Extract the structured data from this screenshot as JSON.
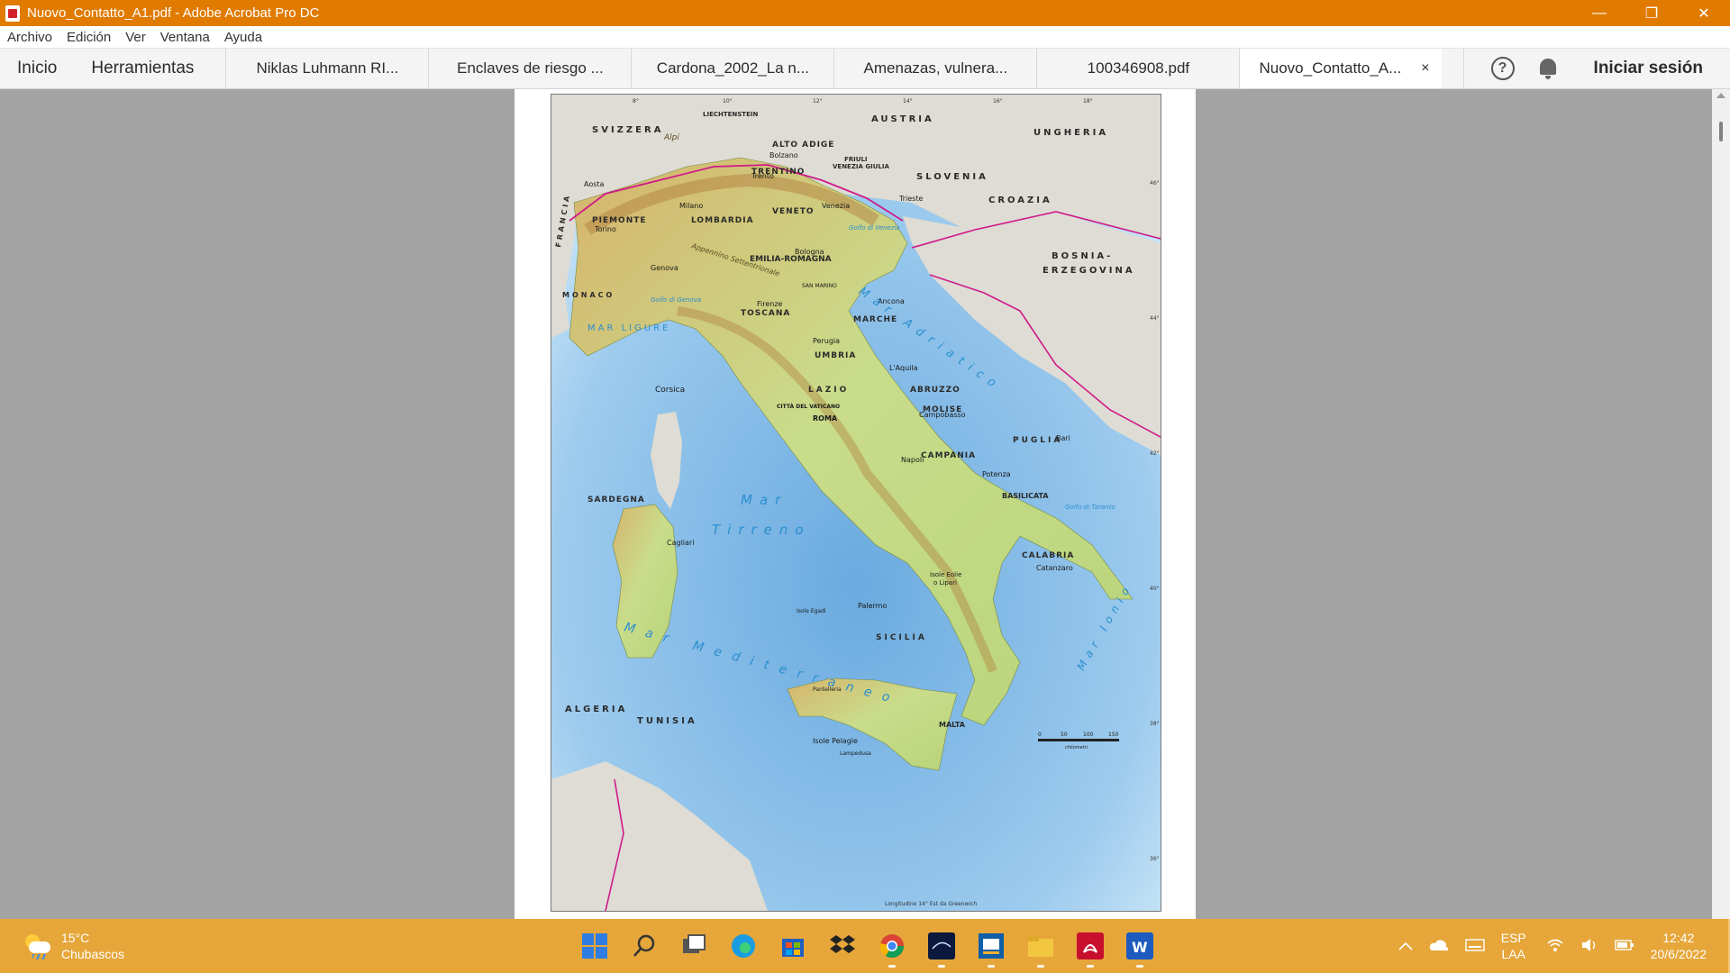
{
  "window": {
    "title": "Nuovo_Contatto_A1.pdf - Adobe Acrobat Pro DC",
    "minimize": "—",
    "restore": "❐",
    "close": "✕"
  },
  "menu": [
    "Archivo",
    "Edición",
    "Ver",
    "Ventana",
    "Ayuda"
  ],
  "toolbar": {
    "home": "Inicio",
    "tools": "Herramientas",
    "tabs": [
      {
        "label": "Niklas Luhmann RI..."
      },
      {
        "label": "Enclaves de riesgo ..."
      },
      {
        "label": "Cardona_2002_La n..."
      },
      {
        "label": "Amenazas, vulnera..."
      },
      {
        "label": "100346908.pdf"
      },
      {
        "label": "Nuovo_Contatto_A...",
        "active": true,
        "close": "×"
      }
    ],
    "help": "?",
    "signin": "Iniciar sesión"
  },
  "map": {
    "sea_labels": {
      "adriatico": "Mar Adriatico",
      "tirreno_1": "Mar",
      "tirreno_2": "Tirreno",
      "mediterraneo": "Mar Mediterraneo",
      "ionio": "Mar Ionio",
      "ligure": "MAR LIGURE",
      "golfo_venezia": "Golfo di Venezia",
      "golfo_genova": "Golfo di Genova",
      "golfo_taranto": "Golfo di Taranto"
    },
    "countries": {
      "svizzera": "SVIZZERA",
      "austria": "AUSTRIA",
      "ungheria": "UNGHERIA",
      "slovenia": "SLOVENIA",
      "croazia": "CROAZIA",
      "bosnia_1": "BOSNIA-",
      "bosnia_2": "ERZEGOVINA",
      "francia": "FRANCIA",
      "monaco": "MONACO",
      "liechtenstein": "LIECHTENSTEIN",
      "algeria": "ALGERIA",
      "tunisia": "TUNISIA",
      "malta": "MALTA"
    },
    "regions": {
      "piemonte": "PIEMONTE",
      "lombardia": "LOMBARDIA",
      "veneto": "VENETO",
      "trentino": "TRENTINO",
      "alto_adige": "ALTO ADIGE",
      "friuli_1": "FRIULI",
      "friuli_2": "VENEZIA GIULIA",
      "emilia": "EMILIA-ROMAGNA",
      "toscana": "TOSCANA",
      "marche": "MARCHE",
      "umbria": "UMBRIA",
      "lazio": "LAZIO",
      "abruzzo": "ABRUZZO",
      "molise": "MOLISE",
      "campania": "CAMPANIA",
      "puglia": "PUGLIA",
      "basilicata": "BASILICATA",
      "calabria": "CALABRIA",
      "sicilia": "SICILIA",
      "sardegna": "SARDEGNA"
    },
    "islands": {
      "corsica": "Corsica",
      "eolie_1": "Isole Eolie",
      "eolie_2": "o Lipari",
      "pelagie": "Isole Pelagie",
      "pantelleria": "Pantelleria",
      "lampedusa": "Lampedusa",
      "egadi": "Isole Egadi"
    },
    "cities": {
      "roma": "ROMA",
      "vaticano": "CITTÀ DEL VATICANO",
      "milano": "Milano",
      "torino": "Torino",
      "genova": "Genova",
      "venezia": "Venezia",
      "trieste": "Trieste",
      "bologna": "Bologna",
      "firenze": "Firenze",
      "ancona": "Ancona",
      "perugia": "Perugia",
      "napoli": "Napoli",
      "bari": "Bari",
      "potenza": "Potenza",
      "catanzaro": "Catanzaro",
      "palermo": "Palermo",
      "cagliari": "Cagliari",
      "aosta": "Aosta",
      "trento": "Trento",
      "bolzano": "Bolzano",
      "laquila": "L'Aquila",
      "campobasso": "Campobasso",
      "san_marino": "SAN MARINO"
    },
    "mountains": {
      "alpi": "Alpi",
      "appennino": "Appennino Settentrionale"
    },
    "scale": {
      "ticks": [
        "0",
        "50",
        "100",
        "150"
      ],
      "unit": "chilometri"
    },
    "longitude_ticks": [
      "8°",
      "10°",
      "12°",
      "14°",
      "16°",
      "18°"
    ],
    "latitude_ticks": [
      "46°",
      "44°",
      "42°",
      "40°",
      "38°",
      "36°"
    ],
    "footer": "Longitudine 14° Est da Greenwich"
  },
  "taskbar": {
    "weather_temp": "15°C",
    "weather_desc": "Chubascos",
    "lang_1": "ESP",
    "lang_2": "LAA",
    "time": "12:42",
    "date": "20/6/2022"
  },
  "colors": {
    "titlebar": "#e07b00",
    "taskbar": "#e6a63a",
    "sea_deep": "#7fb8e6",
    "sea_shallow": "#d6ecf8",
    "land_low": "#c9dc8a",
    "land_high": "#d8b06a",
    "foreign_land": "#d9d9d4",
    "border": "#d0198a"
  }
}
